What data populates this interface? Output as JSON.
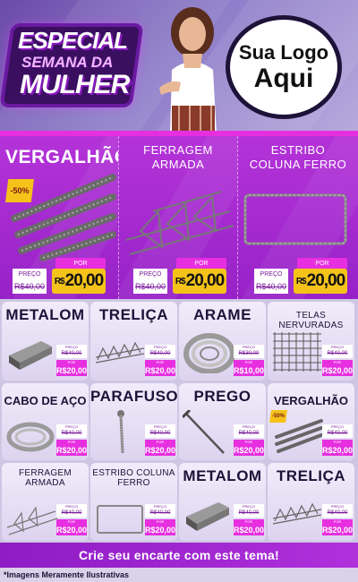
{
  "header": {
    "promo_line1": "ESPECIAL",
    "promo_line2": "SEMANA DA",
    "promo_line3": "MULHER",
    "logo_line1": "Sua Logo",
    "logo_line2": "Aqui"
  },
  "featured": [
    {
      "title": "VERGALHÃO",
      "discount": "-50%",
      "preco_label": "PREÇO",
      "old_price": "R$40,00",
      "por_label": "POR",
      "currency": "R$",
      "new_price": "20,00"
    },
    {
      "title_line1": "FERRAGEM",
      "title_line2": "ARMADA",
      "preco_label": "PREÇO",
      "old_price": "R$40,00",
      "por_label": "POR",
      "currency": "R$",
      "new_price": "20,00"
    },
    {
      "title_line1": "ESTRIBO",
      "title_line2": "COLUNA FERRO",
      "preco_label": "PREÇO",
      "old_price": "R$40,00",
      "por_label": "POR",
      "currency": "R$",
      "new_price": "20,00"
    }
  ],
  "grid": [
    {
      "title": "METALOM",
      "old_price": "R$40,00",
      "new_price": "R$20,00"
    },
    {
      "title": "TRELIÇA",
      "old_price": "R$40,00",
      "new_price": "R$20,00"
    },
    {
      "title": "ARAME",
      "old_price": "R$30,00",
      "new_price": "R$10,00"
    },
    {
      "title_line1": "TELAS",
      "title_line2": "NERVURADAS",
      "old_price": "R$40,00",
      "new_price": "R$20,00"
    },
    {
      "title": "CABO DE AÇO",
      "old_price": "R$40,00",
      "new_price": "R$20,00"
    },
    {
      "title": "PARAFUSO",
      "old_price": "R$40,00",
      "new_price": "R$20,00"
    },
    {
      "title": "PREGO",
      "old_price": "R$40,00",
      "new_price": "R$20,00"
    },
    {
      "title": "VERGALHÃO",
      "discount": "-50%",
      "old_price": "R$40,00",
      "new_price": "R$20,00"
    },
    {
      "title_line1": "FERRAGEM",
      "title_line2": "ARMADA",
      "old_price": "R$40,00",
      "new_price": "R$20,00"
    },
    {
      "title_line1": "ESTRIBO COLUNA",
      "title_line2": "FERRO",
      "old_price": "R$40,00",
      "new_price": "R$20,00"
    },
    {
      "title": "METALOM",
      "old_price": "R$40,00",
      "new_price": "R$20,00"
    },
    {
      "title": "TRELIÇA",
      "old_price": "R$40,00",
      "new_price": "R$20,00"
    }
  ],
  "price_labels": {
    "preco": "PREÇO",
    "por": "POR"
  },
  "cta": "Crie seu encarte com este tema!",
  "footnote": "*Imagens Meramente Ilustrativas",
  "colors": {
    "accent": "#e72fe0",
    "featured_bg": "#a82bd2",
    "price_yellow": "#f5c21a",
    "dark_text": "#1d1238"
  }
}
